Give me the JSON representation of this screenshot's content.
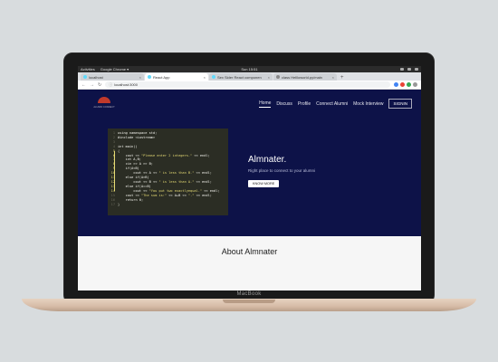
{
  "os_bar": {
    "left_items": [
      "Activities",
      "Google Chrome ▾"
    ],
    "clock": "Sun 15:51"
  },
  "browser": {
    "tabs": [
      {
        "label": "localhost"
      },
      {
        "label": "React App"
      },
      {
        "label": "Sex Sider React componen"
      },
      {
        "label": "class Hellloworld.py/main"
      }
    ],
    "new_tab": "+",
    "url": "localhost:3000",
    "ext_colors": [
      "#4285f4",
      "#ea4335",
      "#34a853",
      "#999999"
    ]
  },
  "site": {
    "logo_tag": "ALUMNI CONNECT",
    "nav": [
      "Home",
      "Discuss",
      "Profile",
      "Connect Alumni",
      "Mock Interview"
    ],
    "signin": "SIGNIN",
    "hero_title": "Almnater.",
    "hero_sub": "Right place to connect to your alumni",
    "hero_button": "KNOW MORE",
    "code_lines": [
      "using namespace std;",
      "#include <iostream>",
      "",
      "int main()",
      "{",
      "    cout << \"Please enter 2 integers.\" << endl;",
      "    int A,B;",
      "    cin >> A >> B;",
      "    if(A<B)",
      "        cout << A << \" is less than B.\" << endl;",
      "    else if(A>B)",
      "        cout << B << \" is less than A.\" << endl;",
      "    else if(A==B)",
      "        cout << \"You put two exactlyequal.\" << endl;",
      "    cout << \"The sum is:\" << A+B << \".\" << endl;",
      "    return 0;",
      "}"
    ],
    "about_title": "About Almnater"
  },
  "laptop_brand": "MacBook"
}
